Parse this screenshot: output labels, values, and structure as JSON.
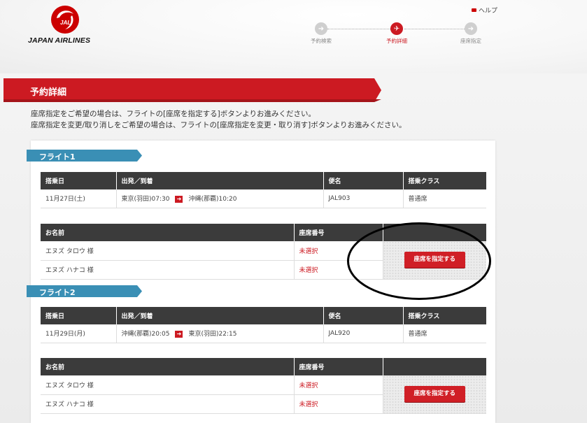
{
  "header": {
    "logo_text": "JAPAN AIRLINES",
    "logo_mark": "JAL",
    "help_label": "ヘルプ",
    "steps": [
      {
        "label": "予約検索",
        "active": false
      },
      {
        "label": "予約詳細",
        "active": true
      },
      {
        "label": "座席指定",
        "active": false
      }
    ]
  },
  "page": {
    "title": "予約詳細",
    "intro_line1": "座席指定をご希望の場合は、フライトの[座席を指定する]ボタンよりお進みください。",
    "intro_line2": "座席指定を変更/取り消しをご希望の場合は、フライトの[座席指定を変更・取り消す]ボタンよりお進みください。"
  },
  "flight_headers": {
    "date": "搭乗日",
    "route": "出発／到着",
    "flight_no": "便名",
    "class": "搭乗クラス"
  },
  "passenger_headers": {
    "name": "お名前",
    "seat": "座席番号"
  },
  "flights": [
    {
      "tab": "フライト1",
      "date": "11月27日(土)",
      "departure": "東京(羽田)07:30",
      "arrival": "沖縄(那覇)10:20",
      "flight_no": "JAL903",
      "class": "普通席",
      "passengers": [
        {
          "name": "エヌズ タロウ 様",
          "seat": "未選択"
        },
        {
          "name": "エヌズ ハナコ 様",
          "seat": "未選択"
        }
      ],
      "button_label": "座席を指定する"
    },
    {
      "tab": "フライト2",
      "date": "11月29日(月)",
      "departure": "沖縄(那覇)20:05",
      "arrival": "東京(羽田)22:15",
      "flight_no": "JAL920",
      "class": "普通席",
      "passengers": [
        {
          "name": "エヌズ タロウ 様",
          "seat": "未選択"
        },
        {
          "name": "エヌズ ハナコ 様",
          "seat": "未選択"
        }
      ],
      "button_label": "座席を指定する"
    }
  ],
  "colors": {
    "brand_red": "#cc1a22",
    "tab_blue": "#3a8fb5",
    "table_header": "#3b3b3b"
  }
}
